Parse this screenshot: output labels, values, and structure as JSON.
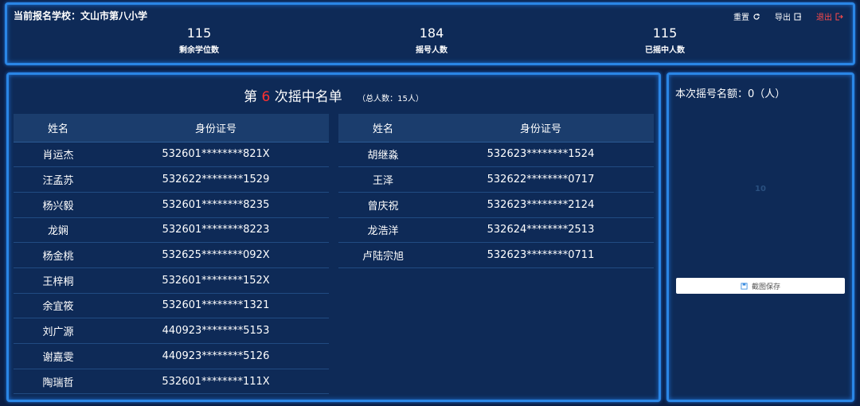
{
  "header": {
    "school_label": "当前报名学校：文山市第八小学",
    "actions": {
      "reset": "重置",
      "export": "导出",
      "logout": "退出"
    },
    "stats": [
      {
        "value": "115",
        "label": "剩余学位数"
      },
      {
        "value": "184",
        "label": "摇号人数"
      },
      {
        "value": "115",
        "label": "已摇中人数"
      }
    ]
  },
  "list": {
    "title_prefix": "第",
    "round": "6",
    "title_suffix": "次摇中名单",
    "total": "（总人数：15人）",
    "col_name": "姓名",
    "col_id": "身份证号",
    "table1": [
      {
        "name": "肖运杰",
        "id": "532601********821X"
      },
      {
        "name": "汪孟苏",
        "id": "532622********1529"
      },
      {
        "name": "杨兴毅",
        "id": "532601********8235"
      },
      {
        "name": "龙娴",
        "id": "532601********8223"
      },
      {
        "name": "杨金桃",
        "id": "532625********092X"
      },
      {
        "name": "王梓桐",
        "id": "532601********152X"
      },
      {
        "name": "余宜筱",
        "id": "532601********1321"
      },
      {
        "name": "刘广源",
        "id": "440923********5153"
      },
      {
        "name": "谢嘉雯",
        "id": "440923********5126"
      },
      {
        "name": "陶瑞哲",
        "id": "532601********111X"
      }
    ],
    "table2": [
      {
        "name": "胡继淼",
        "id": "532623********1524"
      },
      {
        "name": "王泽",
        "id": "532622********0717"
      },
      {
        "name": "曾庆祝",
        "id": "532623********2124"
      },
      {
        "name": "龙浩洋",
        "id": "532624********2513"
      },
      {
        "name": "卢陆宗旭",
        "id": "532623********0711"
      }
    ]
  },
  "side": {
    "quota_label": "本次摇号名额：0（人）",
    "placeholder": "10",
    "save_label": "截图保存"
  },
  "colors": {
    "accent_border": "#2a86e6",
    "panel_bg": "#0e2a57",
    "round_highlight": "#ff3030",
    "logout": "#ff4a4a"
  }
}
